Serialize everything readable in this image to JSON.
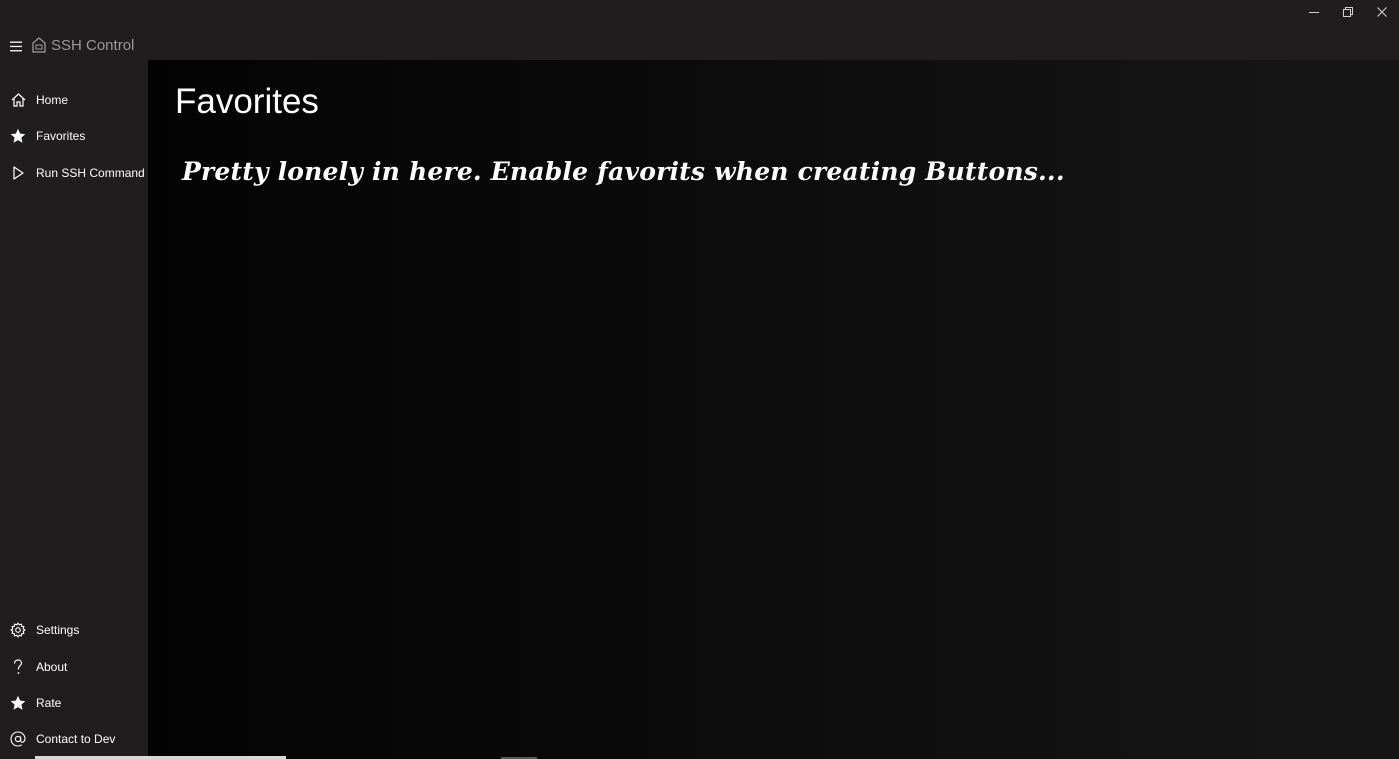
{
  "window": {
    "title": "SSH Control",
    "controls": {
      "minimize_icon": "minimize-icon",
      "restore_icon": "restore-icon",
      "close_icon": "close-icon"
    }
  },
  "sidebar": {
    "menu_icon": "hamburger-icon",
    "items": [
      {
        "label": "Home",
        "icon": "home-icon"
      },
      {
        "label": "Favorites",
        "icon": "star-icon"
      },
      {
        "label": "Run SSH Command",
        "icon": "play-icon"
      }
    ],
    "footer_items": [
      {
        "label": "Settings",
        "icon": "gear-icon"
      },
      {
        "label": "About",
        "icon": "question-icon"
      },
      {
        "label": "Rate",
        "icon": "star-icon"
      },
      {
        "label": "Contact to Dev",
        "icon": "at-icon"
      }
    ]
  },
  "main": {
    "title": "Favorites",
    "empty_message": "Pretty lonely in here. Enable favorits when creating Buttons..."
  },
  "colors": {
    "background": "#1f1d1e",
    "content_background": "#050505",
    "text": "#ffffff",
    "title_text": "#9a9a9a"
  }
}
